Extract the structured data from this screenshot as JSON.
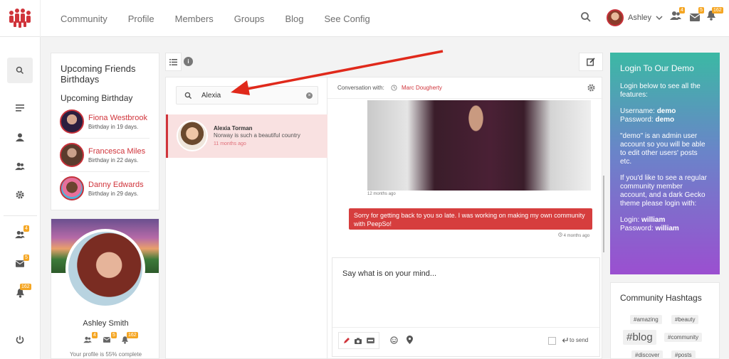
{
  "nav": {
    "items": [
      "Community",
      "Profile",
      "Members",
      "Groups",
      "Blog",
      "See Config"
    ]
  },
  "user": {
    "name": "Ashley",
    "badges": {
      "friends": "4",
      "messages": "5",
      "notifications": "162"
    }
  },
  "rail": {
    "badges": {
      "friends": "4",
      "messages": "5",
      "notifications": "162"
    }
  },
  "birthdays": {
    "title": "Upcoming Friends Birthdays",
    "subtitle": "Upcoming Birthday",
    "items": [
      {
        "name": "Fiona Westbrook",
        "date": "Birthday in 19 days."
      },
      {
        "name": "Francesca Miles",
        "date": "Birthday in 22 days."
      },
      {
        "name": "Danny Edwards",
        "date": "Birthday in 29 days."
      }
    ]
  },
  "profile": {
    "name": "Ashley Smith",
    "completion_text": "Your profile is 55% complete",
    "badges": {
      "friends": "4",
      "messages": "5",
      "notifications": "162"
    }
  },
  "conversations": {
    "search_value": "Alexia",
    "items": [
      {
        "name": "Alexia Torman",
        "preview": "Norway is such a beautiful country",
        "time": "11 months ago"
      }
    ]
  },
  "chat": {
    "conversation_with_label": "Conversation with:",
    "partner": "Marc Dougherty",
    "image_time": "12 months ago",
    "messages": [
      {
        "text": "Sorry for getting back to you so late. I was working on making my own community with PeepSo!",
        "time": "4 months ago"
      }
    ],
    "composer_placeholder": "Say what is on your mind...",
    "to_send_label": "to send"
  },
  "demo": {
    "title": "Login To Our Demo",
    "intro": "Login below to see all the features:",
    "username_label": "Username:",
    "username": "demo",
    "password_label": "Password:",
    "password": "demo",
    "admin_note": "\"demo\" is an admin user account so you will be able to edit other users' posts etc.",
    "regular_note": "If you'd like to see a regular community member account, and a dark Gecko theme please login with:",
    "login_label": "Login:",
    "login": "william",
    "password2_label": "Password:",
    "password2": "william"
  },
  "hashtags": {
    "title": "Community Hashtags",
    "tags": [
      "#amazing",
      "#beauty",
      "#blog",
      "#community",
      "#discover",
      "#posts"
    ]
  },
  "colors": {
    "accent": "#d0343b",
    "badge": "#f5a623",
    "purple_top": "#3bb9a4",
    "purple_bottom": "#9b4fd0"
  },
  "icons": [
    "logo-icon",
    "search-icon",
    "menu-icon",
    "user-icon",
    "friends-icon",
    "gear-icon",
    "envelope-icon",
    "bell-icon",
    "power-icon",
    "edit-icon",
    "info-icon",
    "list-icon",
    "clock-icon",
    "pencil-icon",
    "camera-icon",
    "gif-icon",
    "smile-icon",
    "location-icon",
    "send-icon",
    "close-icon",
    "chevron-down-icon"
  ]
}
